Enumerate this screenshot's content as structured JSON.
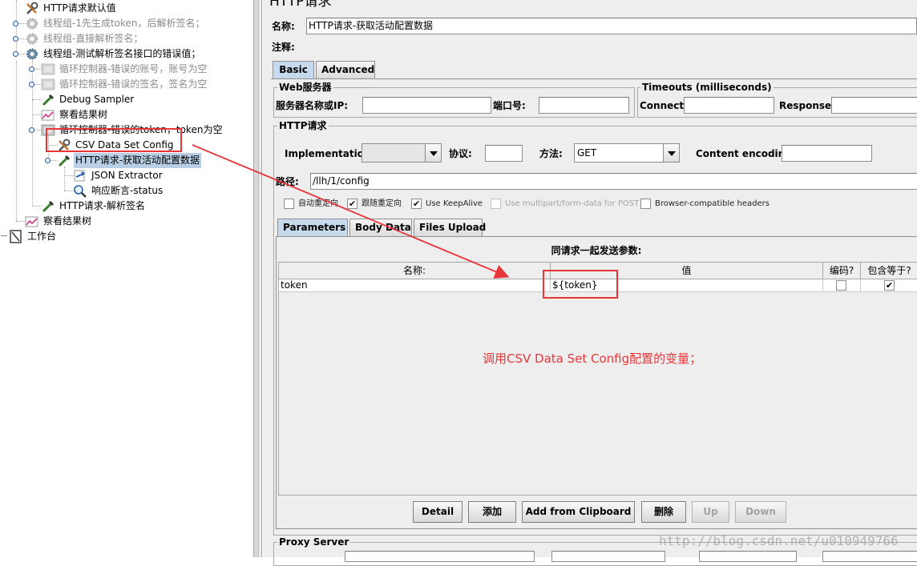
{
  "tree": {
    "nodes": [
      {
        "label": "HTTP请求默认值",
        "icon": "wrench-icon",
        "disabled": false
      },
      {
        "label": "线程组-1先生成token，后解析签名；",
        "icon": "gear-icon",
        "disabled": true
      },
      {
        "label": "线程组-直接解析签名；",
        "icon": "gear-icon",
        "disabled": true
      },
      {
        "label": "线程组-测试解析签名接口的错误值；",
        "icon": "gear-icon",
        "disabled": false
      },
      {
        "label": "循环控制器-错误的账号，账号为空",
        "icon": "loop-icon",
        "disabled": true
      },
      {
        "label": "循环控制器-错误的签名，签名为空",
        "icon": "loop-icon",
        "disabled": true
      },
      {
        "label": "Debug Sampler",
        "icon": "pipette-icon",
        "disabled": false
      },
      {
        "label": "察看结果树",
        "icon": "chart-icon",
        "disabled": false
      },
      {
        "label": "循环控制器-错误的token，token为空",
        "icon": "loop-icon",
        "disabled": false
      },
      {
        "label": "CSV Data Set Config",
        "icon": "wrench-icon",
        "disabled": false
      },
      {
        "label": "HTTP请求-获取活动配置数据",
        "icon": "pipette-icon",
        "disabled": false
      },
      {
        "label": "JSON Extractor",
        "icon": "arrow-icon",
        "disabled": false
      },
      {
        "label": "响应断言-status",
        "icon": "magnifier-icon",
        "disabled": false
      },
      {
        "label": "HTTP请求-解析签名",
        "icon": "pipette-icon",
        "disabled": false
      },
      {
        "label": "察看结果树",
        "icon": "chart-icon",
        "disabled": false
      },
      {
        "label": "工作台",
        "icon": "workbench-icon",
        "disabled": false
      }
    ]
  },
  "panel": {
    "title": "HTTP请求",
    "name_label": "名称:",
    "name_value": "HTTP请求-获取活动配置数据",
    "comment_label": "注释:",
    "comment_value": "",
    "tabs": [
      "Basic",
      "Advanced"
    ],
    "web_server": {
      "title": "Web服务器",
      "server_label": "服务器名称或IP:",
      "server_value": "",
      "port_label": "端口号:",
      "port_value": ""
    },
    "timeouts": {
      "title": "Timeouts (milliseconds)",
      "connect_label": "Connect:",
      "connect_value": "",
      "response_label": "Response:",
      "response_value": ""
    },
    "http_request": {
      "title": "HTTP请求",
      "implementation_label": "Implementation:",
      "implementation_value": "",
      "protocol_label": "协议:",
      "protocol_value": "",
      "method_label": "方法:",
      "method_value": "GET",
      "encoding_label": "Content encoding:",
      "encoding_value": "",
      "path_label": "路径:",
      "path_value": "/llh/1/config"
    },
    "checkboxes": [
      {
        "label": "自动重定向",
        "checked": false,
        "disabled": false
      },
      {
        "label": "跟随重定向",
        "checked": true,
        "disabled": false
      },
      {
        "label": "Use KeepAlive",
        "checked": true,
        "disabled": false
      },
      {
        "label": "Use multipart/form-data for POST",
        "checked": false,
        "disabled": true
      },
      {
        "label": "Browser-compatible headers",
        "checked": false,
        "disabled": false
      }
    ],
    "subtabs": [
      "Parameters",
      "Body Data",
      "Files Upload"
    ],
    "params": {
      "caption": "同请求一起发送参数:",
      "columns": [
        "名称:",
        "值",
        "编码?",
        "包含等于?"
      ],
      "rows": [
        {
          "name": "token",
          "value": "${token}",
          "encode": false,
          "include_equals": true
        }
      ]
    },
    "annotation": "调用CSV Data Set Config配置的变量；",
    "buttons": [
      {
        "label": "Detail",
        "disabled": false
      },
      {
        "label": "添加",
        "disabled": false
      },
      {
        "label": "Add from Clipboard",
        "disabled": false
      },
      {
        "label": "删除",
        "disabled": false
      },
      {
        "label": "Up",
        "disabled": true
      },
      {
        "label": "Down",
        "disabled": true
      }
    ],
    "proxy_title": "Proxy Server"
  },
  "watermark": "http://blog.csdn.net/u010949766",
  "colors": {
    "annotation": "#e8353a",
    "selection": "#b8cfe5",
    "tab_active": "#c7d9ec"
  }
}
